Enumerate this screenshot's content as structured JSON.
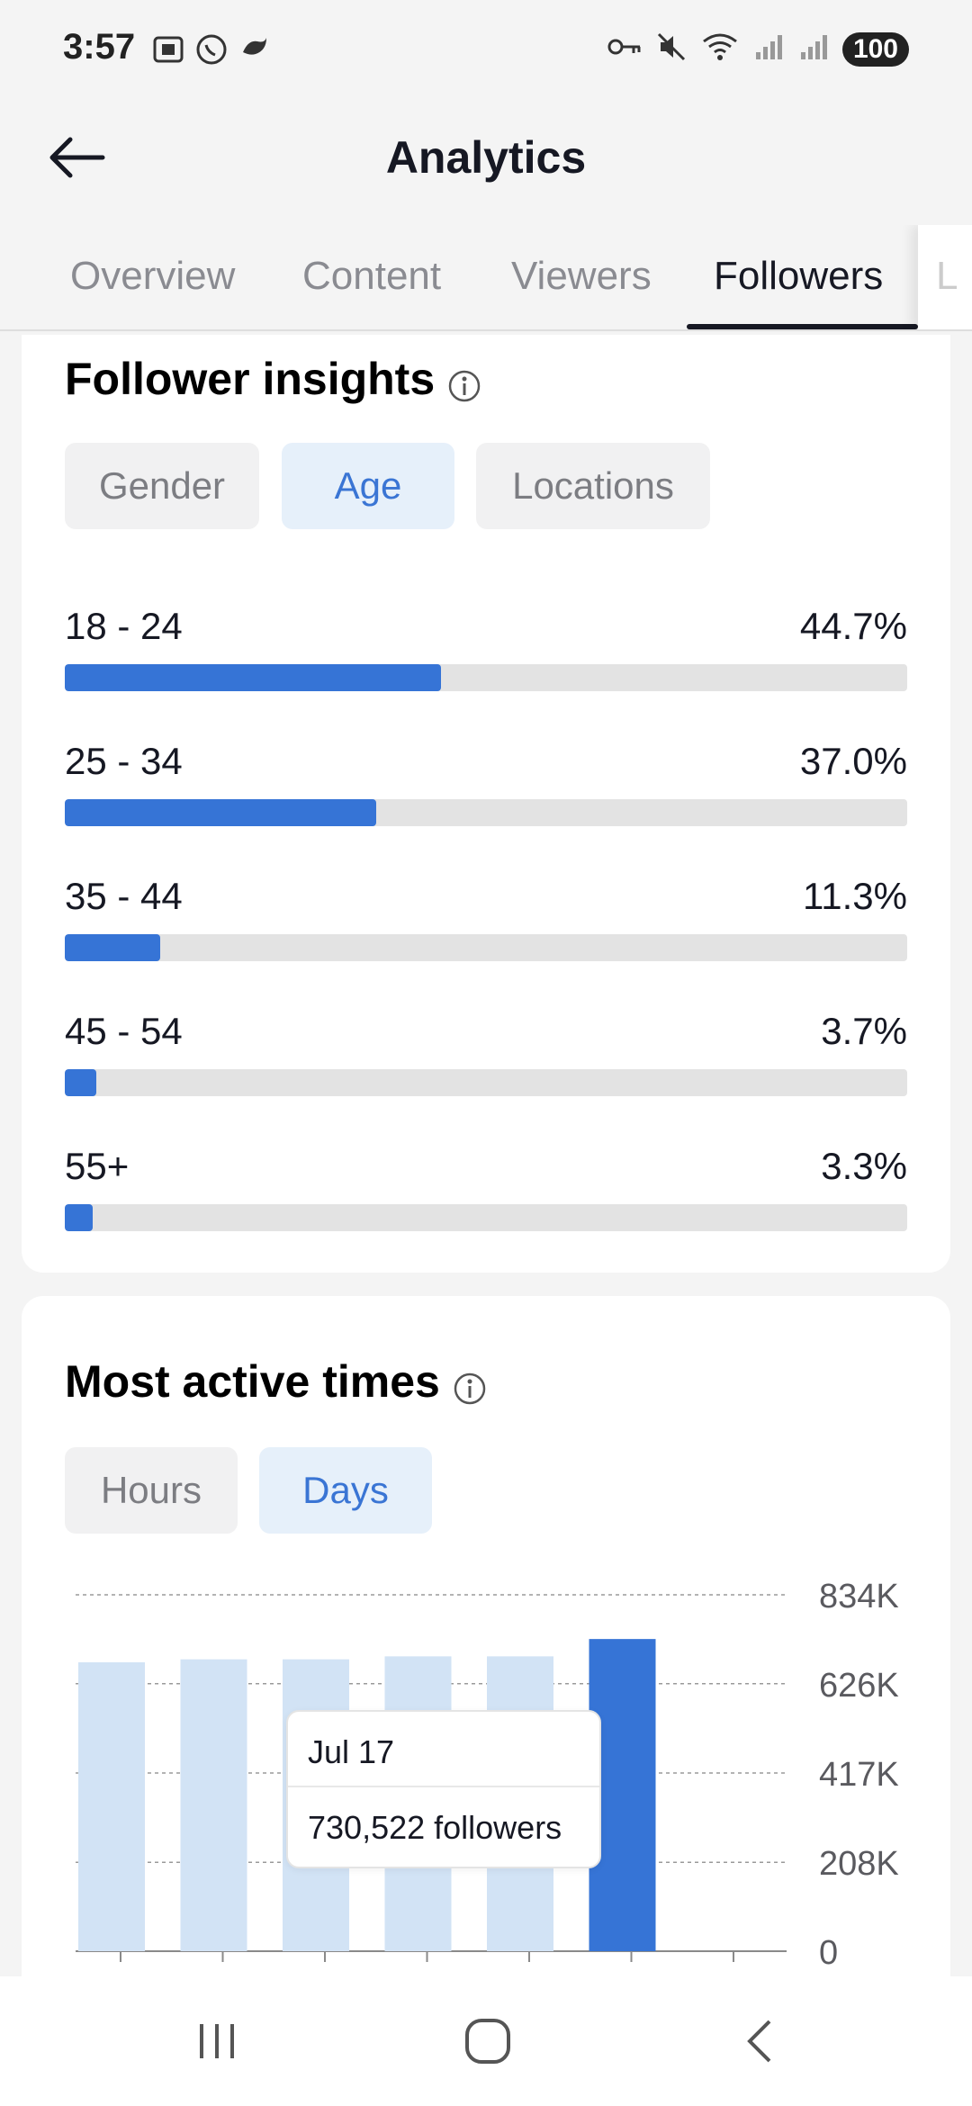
{
  "status_bar": {
    "time": "3:57",
    "battery": "100"
  },
  "header": {
    "title": "Analytics"
  },
  "tabs": [
    {
      "label": "Overview",
      "active": false
    },
    {
      "label": "Content",
      "active": false
    },
    {
      "label": "Viewers",
      "active": false
    },
    {
      "label": "Followers",
      "active": true
    },
    {
      "label": "L",
      "active": false
    }
  ],
  "follower_insights": {
    "title": "Follower insights",
    "filters": [
      {
        "label": "Gender",
        "active": false
      },
      {
        "label": "Age",
        "active": true
      },
      {
        "label": "Locations",
        "active": false
      }
    ],
    "rows": [
      {
        "label": "18 - 24",
        "percent_text": "44.7%",
        "percent": 44.7
      },
      {
        "label": "25 - 34",
        "percent_text": "37.0%",
        "percent": 37.0
      },
      {
        "label": "35 - 44",
        "percent_text": "11.3%",
        "percent": 11.3
      },
      {
        "label": "45 - 54",
        "percent_text": "3.7%",
        "percent": 3.7
      },
      {
        "label": "55+",
        "percent_text": "3.3%",
        "percent": 3.3
      }
    ]
  },
  "most_active": {
    "title": "Most active times",
    "filters": [
      {
        "label": "Hours",
        "active": false
      },
      {
        "label": "Days",
        "active": true
      }
    ],
    "tooltip": {
      "date": "Jul 17",
      "value": "730,522 followers"
    }
  },
  "chart_data": {
    "type": "bar",
    "categories": [
      "",
      "",
      "",
      "",
      "",
      "",
      ""
    ],
    "values": [
      676000,
      683000,
      683000,
      690000,
      690000,
      730522,
      0
    ],
    "highlight_index": 5,
    "y_ticks": [
      "834K",
      "626K",
      "417K",
      "208K",
      "0"
    ],
    "y_tick_values": [
      834000,
      626000,
      417000,
      208000,
      0
    ],
    "ylim": [
      0,
      834000
    ],
    "colors": {
      "bar": "#d2e3f5",
      "highlight": "#3674d6"
    },
    "grid": true
  }
}
